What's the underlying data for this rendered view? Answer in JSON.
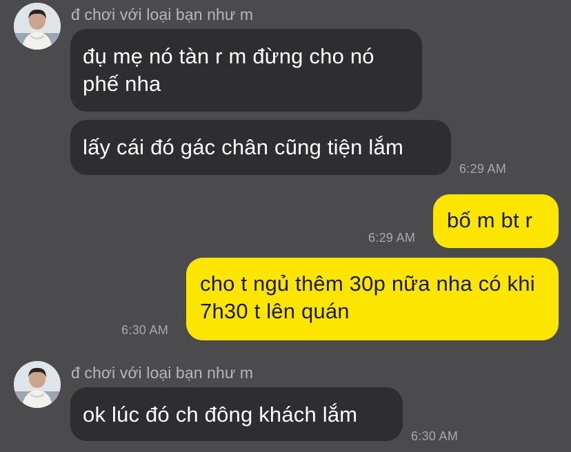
{
  "contact": {
    "name": "đ chơi với loại bạn như m",
    "avatar_icon": "profile-photo"
  },
  "colors": {
    "background": "#4b4a4c",
    "incoming_bubble": "#2e2d2f",
    "outgoing_bubble": "#fce500"
  },
  "messages": [
    {
      "direction": "incoming",
      "text": "đụ mẹ nó tàn r m đừng cho nó phế nha",
      "time": ""
    },
    {
      "direction": "incoming",
      "text": "lấy cái đó gác chân cũng tiện lắm",
      "time": "6:29 AM"
    },
    {
      "direction": "outgoing",
      "text": "bố m bt r",
      "time": "6:29 AM"
    },
    {
      "direction": "outgoing",
      "text": "cho t ngủ thêm 30p nữa nha có khi 7h30 t lên quán",
      "time": "6:30 AM"
    },
    {
      "direction": "incoming",
      "text": "ok lúc đó ch đông khách lắm",
      "time": "6:30 AM"
    }
  ]
}
